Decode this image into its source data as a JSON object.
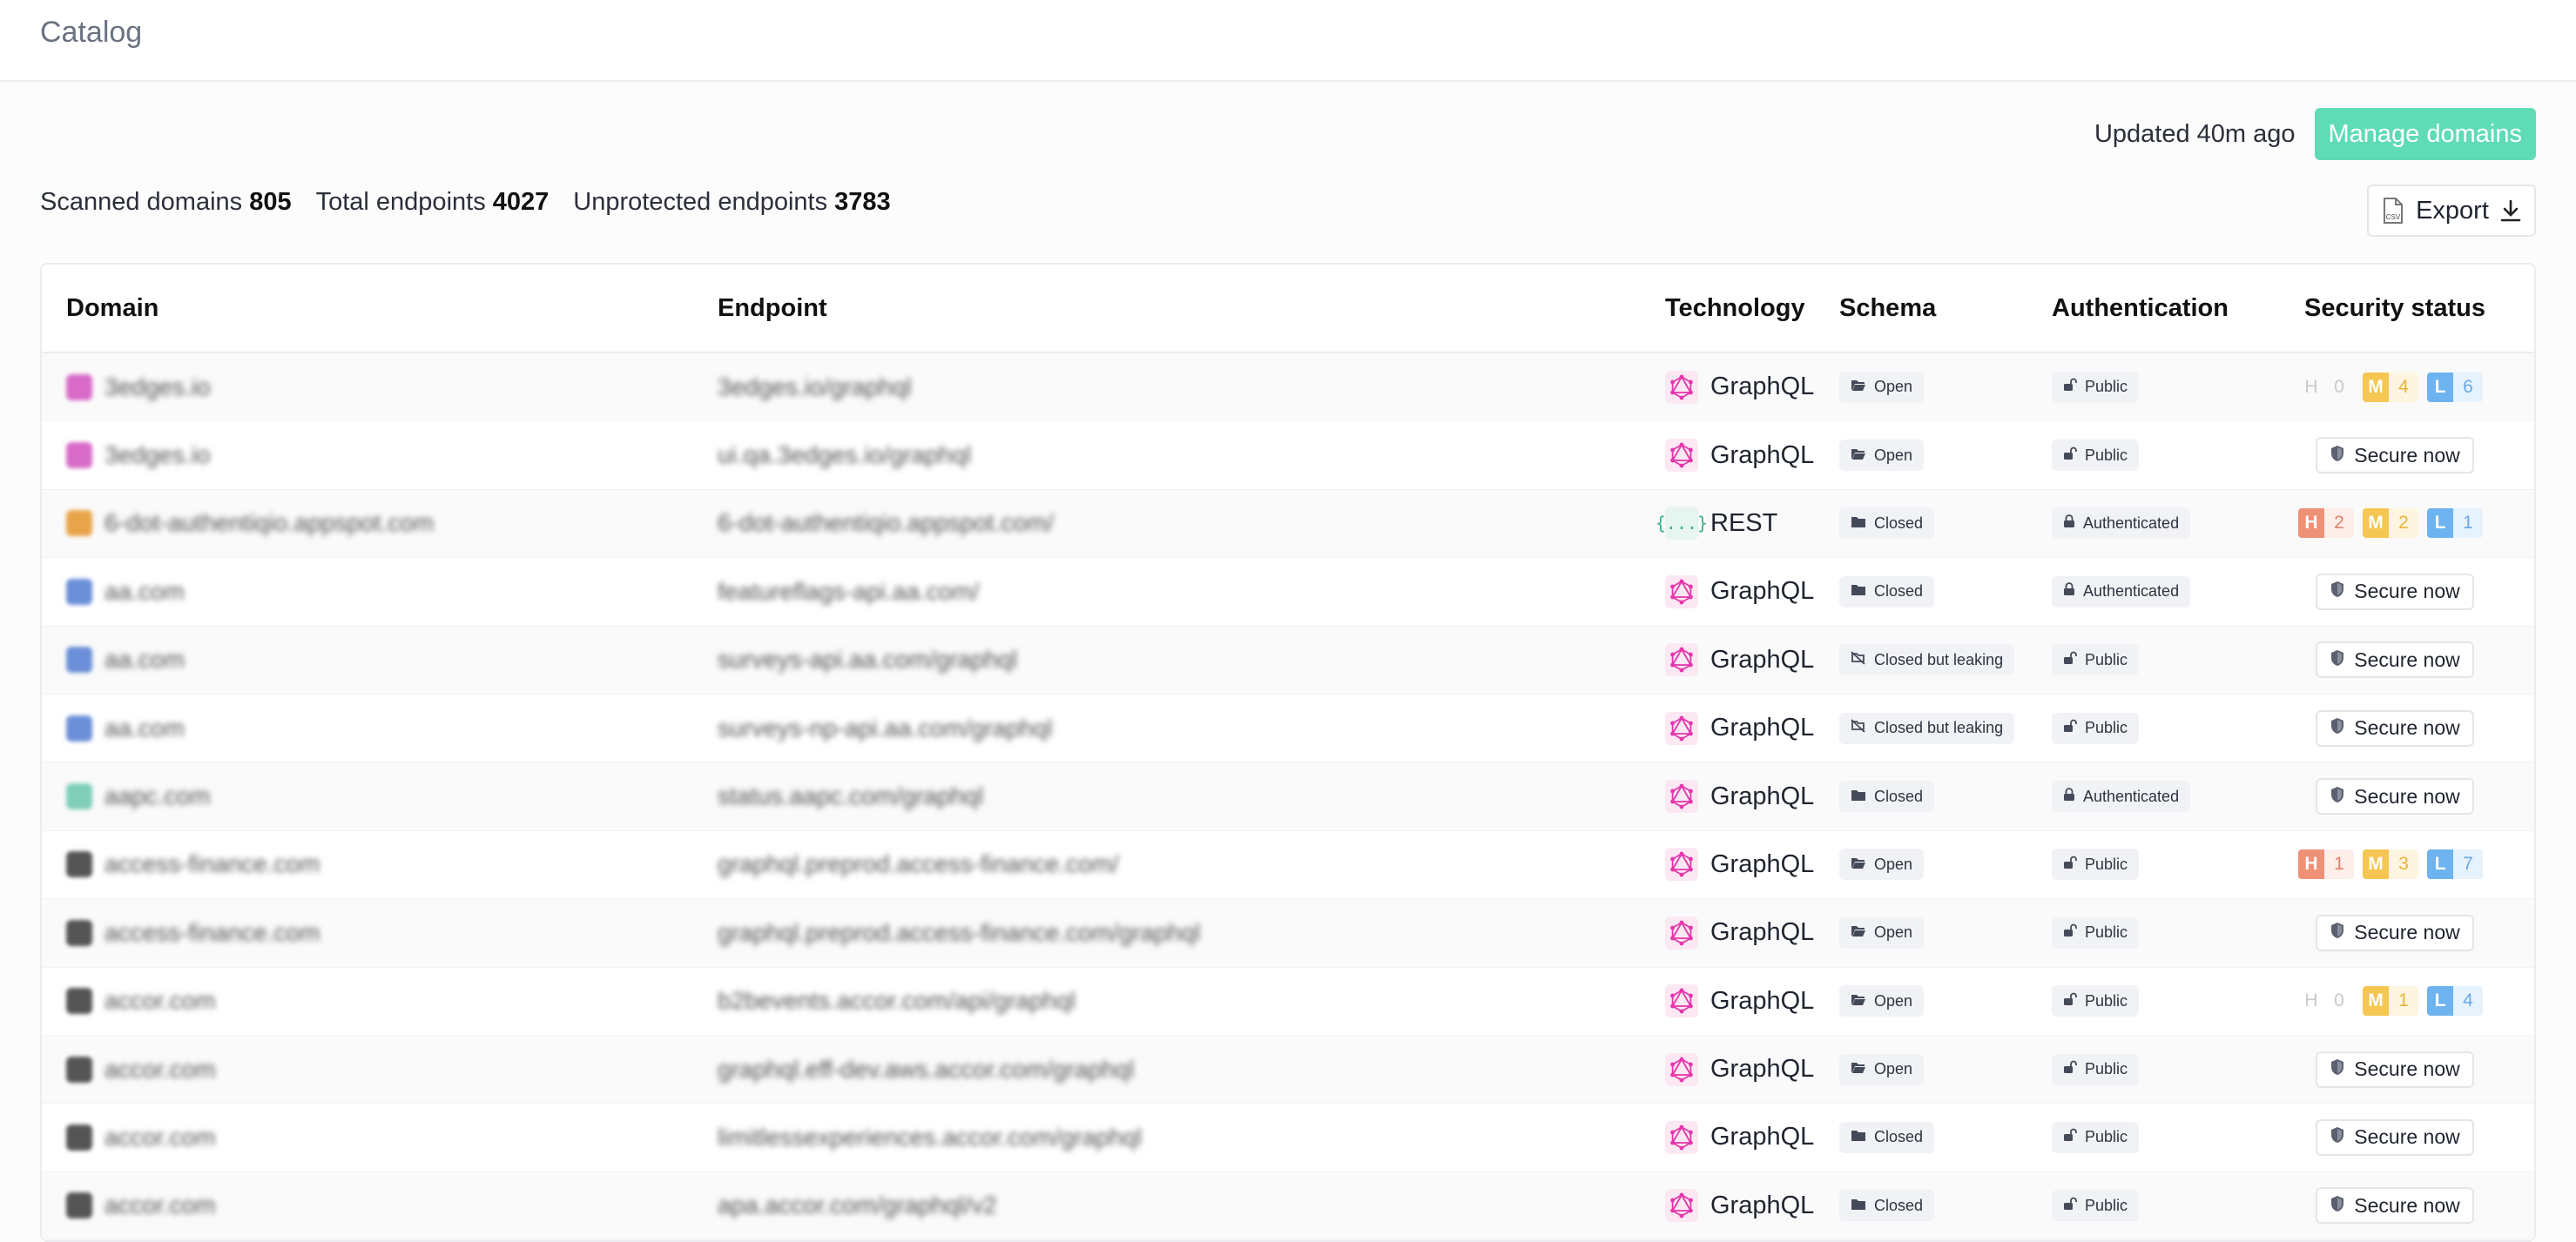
{
  "page": {
    "title": "Catalog"
  },
  "header": {
    "updated": "Updated 40m ago",
    "manage_label": "Manage domains"
  },
  "stats": {
    "scanned_label": "Scanned domains",
    "scanned_value": "805",
    "endpoints_label": "Total endpoints",
    "endpoints_value": "4027",
    "unprotected_label": "Unprotected endpoints",
    "unprotected_value": "3783"
  },
  "export": {
    "label": "Export",
    "file_badge": "CSV"
  },
  "table": {
    "columns": [
      "Domain",
      "Endpoint",
      "Technology",
      "Schema",
      "Authentication",
      "Security status"
    ],
    "secure_label": "Secure now",
    "rows": [
      {
        "domain": "3edges.io",
        "endpoint": "3edges.io/graphql",
        "tech": "GraphQL",
        "schema": "Open",
        "auth": "Public",
        "sec": {
          "H": "0",
          "M": "4",
          "L": "6"
        },
        "fav": "#d86bc8"
      },
      {
        "domain": "3edges.io",
        "endpoint": "ui.qa.3edges.io/graphql",
        "tech": "GraphQL",
        "schema": "Open",
        "auth": "Public",
        "sec": null,
        "fav": "#d86bc8"
      },
      {
        "domain": "6-dot-authentiqio.appspot.com",
        "endpoint": "6-dot-authentiqio.appspot.com/",
        "tech": "REST",
        "schema": "Closed",
        "auth": "Authenticated",
        "sec": {
          "H": "2",
          "M": "2",
          "L": "1"
        },
        "fav": "#e8a44a"
      },
      {
        "domain": "aa.com",
        "endpoint": "featureflags-api.aa.com/",
        "tech": "GraphQL",
        "schema": "Closed",
        "auth": "Authenticated",
        "sec": null,
        "fav": "#6b8fd8"
      },
      {
        "domain": "aa.com",
        "endpoint": "surveys-api.aa.com/graphql",
        "tech": "GraphQL",
        "schema": "Closed but leaking",
        "auth": "Public",
        "sec": null,
        "fav": "#6b8fd8"
      },
      {
        "domain": "aa.com",
        "endpoint": "surveys-np-api.aa.com/graphql",
        "tech": "GraphQL",
        "schema": "Closed but leaking",
        "auth": "Public",
        "sec": null,
        "fav": "#6b8fd8"
      },
      {
        "domain": "aapc.com",
        "endpoint": "status.aapc.com/graphql",
        "tech": "GraphQL",
        "schema": "Closed",
        "auth": "Authenticated",
        "sec": null,
        "fav": "#7fcfb8"
      },
      {
        "domain": "access-finance.com",
        "endpoint": "graphql.preprod.access-finance.com/",
        "tech": "GraphQL",
        "schema": "Open",
        "auth": "Public",
        "sec": {
          "H": "1",
          "M": "3",
          "L": "7"
        },
        "fav": "#555555"
      },
      {
        "domain": "access-finance.com",
        "endpoint": "graphql.preprod.access-finance.com/graphql",
        "tech": "GraphQL",
        "schema": "Open",
        "auth": "Public",
        "sec": null,
        "fav": "#555555"
      },
      {
        "domain": "accor.com",
        "endpoint": "b2bevents.accor.com/api/graphql",
        "tech": "GraphQL",
        "schema": "Open",
        "auth": "Public",
        "sec": {
          "H": "0",
          "M": "1",
          "L": "4"
        },
        "fav": "#555555"
      },
      {
        "domain": "accor.com",
        "endpoint": "graphql.eff-dev.aws.accor.com/graphql",
        "tech": "GraphQL",
        "schema": "Open",
        "auth": "Public",
        "sec": null,
        "fav": "#555555"
      },
      {
        "domain": "accor.com",
        "endpoint": "limitlessexperiences.accor.com/graphql",
        "tech": "GraphQL",
        "schema": "Closed",
        "auth": "Public",
        "sec": null,
        "fav": "#555555"
      },
      {
        "domain": "accor.com",
        "endpoint": "apa.accor.com/graphql/v2",
        "tech": "GraphQL",
        "schema": "Closed",
        "auth": "Public",
        "sec": null,
        "fav": "#555555"
      }
    ]
  },
  "colors": {
    "accent": "#5fdcb5",
    "graphql": "#e535ab",
    "high": "#ee9177",
    "medium": "#f5c651",
    "low": "#6db3ef"
  },
  "icons": {
    "graphql": "graphql-logo-icon",
    "rest": "rest-braces-icon",
    "open": "folder-open-icon",
    "closed": "folder-icon",
    "leaking": "folder-leak-icon",
    "public": "unlock-icon",
    "authenticated": "lock-icon",
    "shield": "shield-icon",
    "export": "download-icon",
    "csv": "csv-file-icon"
  }
}
